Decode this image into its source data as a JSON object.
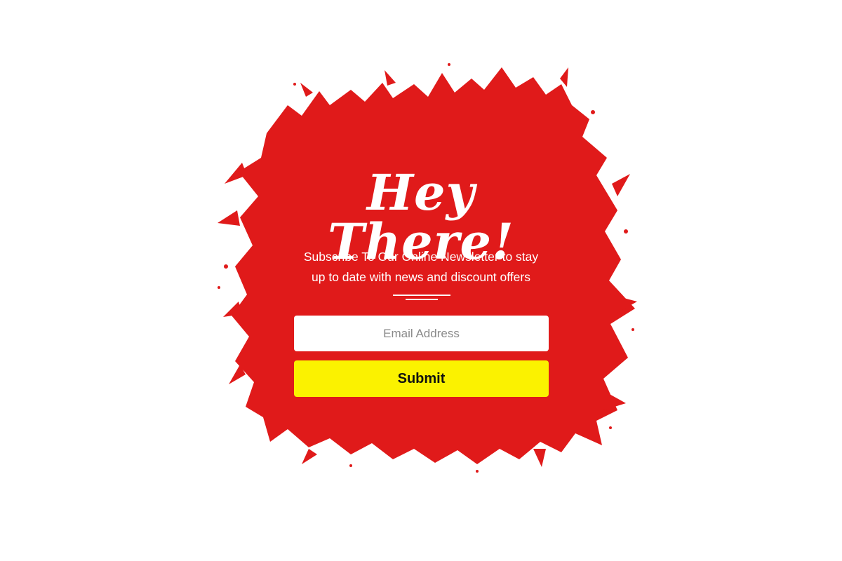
{
  "colors": {
    "splash": "#e01a1a",
    "text": "#ffffff",
    "button": "#fbf200",
    "button_text": "#111111",
    "placeholder": "#8a8a8a"
  },
  "popup": {
    "headline": "Hey There!",
    "subtitle_line1": "Subscribe To Our Online Newsletter to stay",
    "subtitle_line2": "up to date with news and discount offers",
    "email_placeholder": "Email Address",
    "email_value": "",
    "submit_label": "Submit"
  }
}
